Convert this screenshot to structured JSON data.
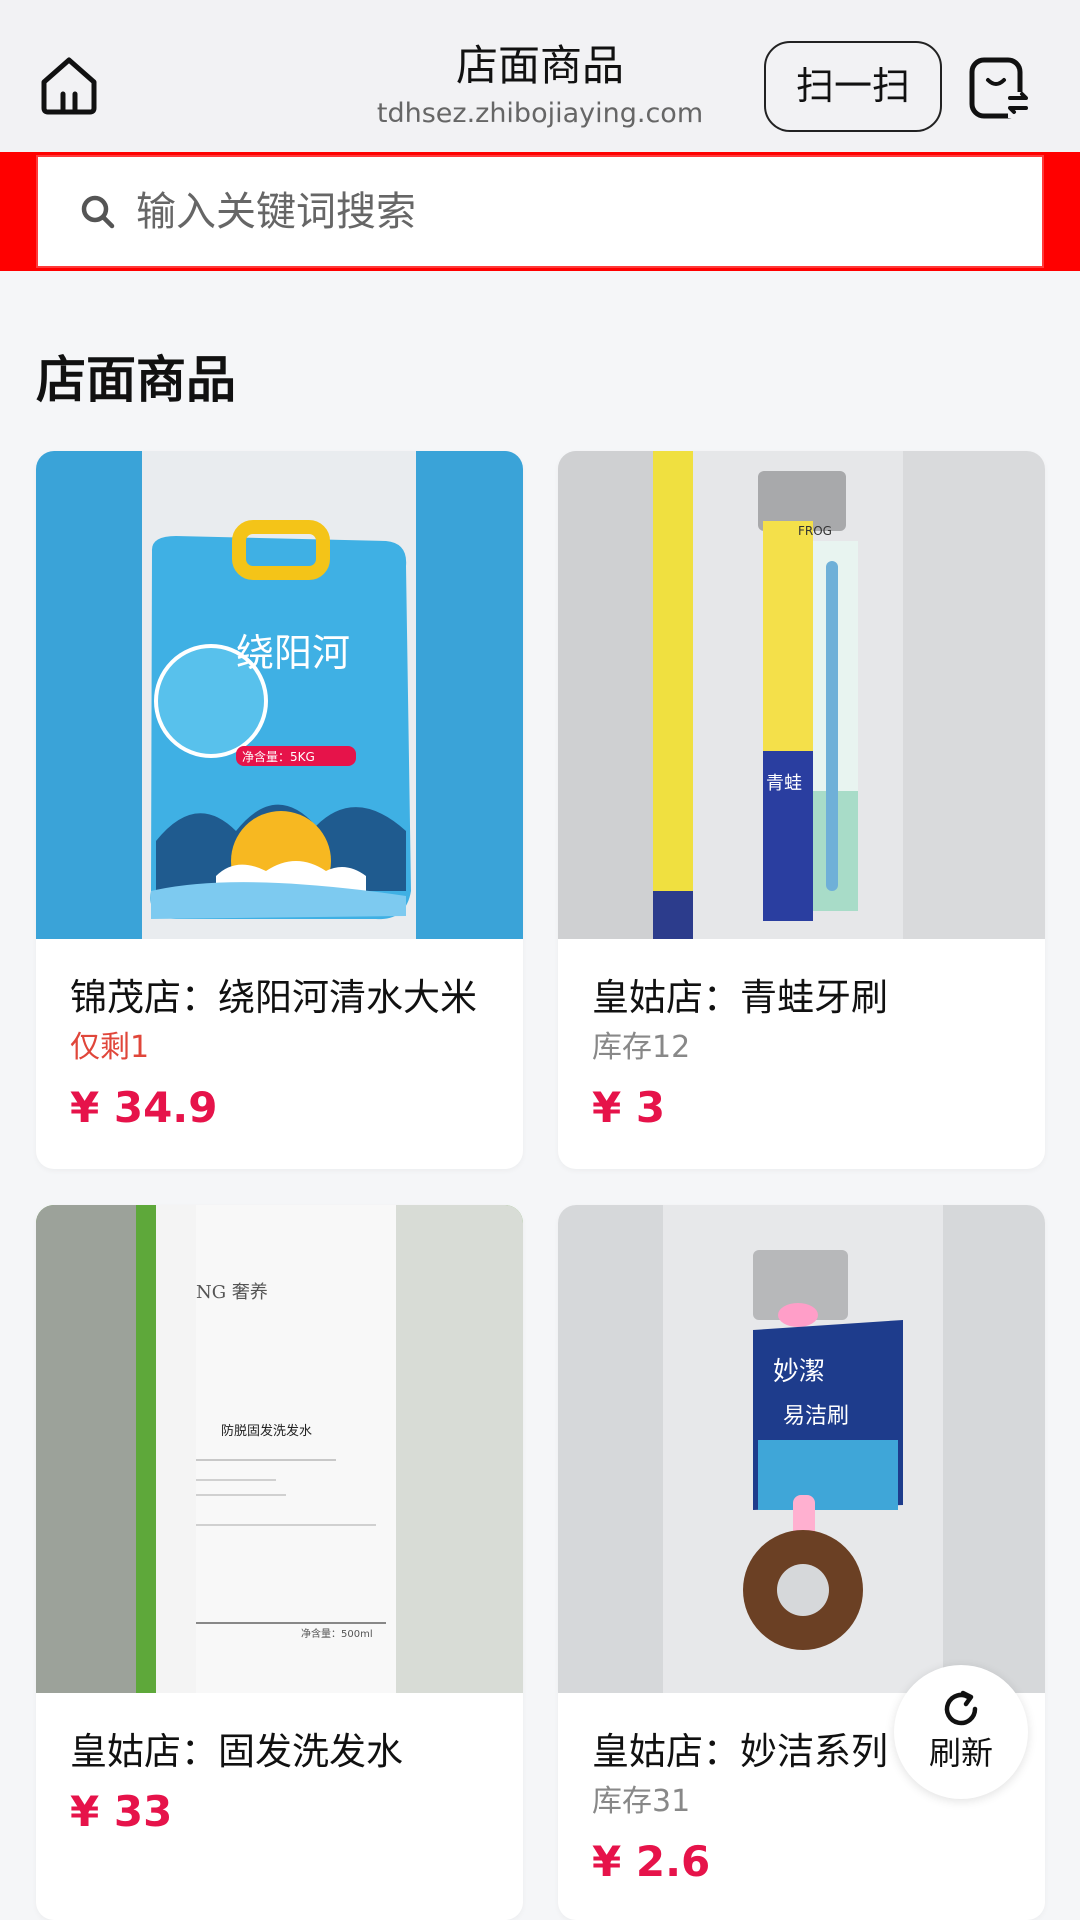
{
  "header": {
    "title": "店面商品",
    "domain": "tdhsez.zhibojiaying.com",
    "scan_label": "扫一扫",
    "home_icon": "home-icon",
    "mini_icon": "mini-program-icon"
  },
  "search": {
    "placeholder": "输入关键词搜索",
    "icon": "search-icon"
  },
  "section": {
    "title": "店面商品"
  },
  "products": [
    {
      "name": "锦茂店：绕阳河清水大米",
      "stock": "仅剩1",
      "price": "¥ 34.9"
    },
    {
      "name": "皇姑店：青蛙牙刷",
      "stock": "库存12",
      "price": "¥ 3"
    },
    {
      "name": "皇姑店：固发洗发水",
      "stock": "",
      "price": "¥ 33"
    },
    {
      "name": "皇姑店：妙洁系列",
      "stock": "库存31",
      "price": "¥ 2.6"
    }
  ],
  "product_image_text": {
    "rice_brand": "绕阳河",
    "rice_net": "净含量：5KG",
    "toothbrush_brand": "FROG",
    "toothbrush_cn": "青蛙",
    "shampoo_brand": "NG 奢养",
    "shampoo_title": "防脱固发洗发水",
    "shampoo_volume": "净含量：500ml",
    "brush_brand": "妙潔",
    "brush_title": "易洁刷"
  },
  "refresh": {
    "label": "刷新",
    "icon": "refresh-icon"
  },
  "colors": {
    "accent": "#e6134a",
    "search_bar": "#ff0000",
    "low_stock": "#e0463a"
  }
}
